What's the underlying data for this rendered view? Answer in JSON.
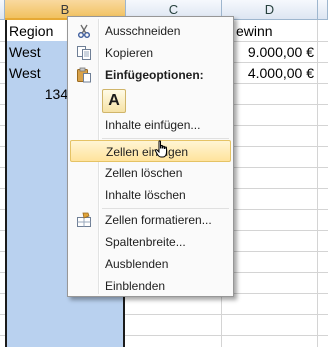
{
  "sheet": {
    "columns": [
      "B",
      "C",
      "D"
    ],
    "cells": {
      "b1": "Region",
      "b2": "West",
      "b3": "West",
      "b4_partial": "134.",
      "d1_partial": "ewinn",
      "d2_partial": "9.000,00 €",
      "d3_partial": "4.000,00 €"
    },
    "selection_color": "#b9d1ef"
  },
  "context_menu": {
    "items": [
      {
        "label": "Ausschneiden",
        "icon": "scissors-icon"
      },
      {
        "label": "Kopieren",
        "icon": "copy-icon"
      },
      {
        "label": "Einfügeoptionen:",
        "icon": "paste-icon"
      },
      {
        "label": "Inhalte einfügen...",
        "icon": ""
      },
      {
        "label": "Zellen einfügen",
        "icon": "",
        "hovered": true
      },
      {
        "label": "Zellen löschen",
        "icon": ""
      },
      {
        "label": "Inhalte löschen",
        "icon": ""
      },
      {
        "label": "Zellen formatieren...",
        "icon": "format-cells-icon"
      },
      {
        "label": "Spaltenbreite...",
        "icon": ""
      },
      {
        "label": "Ausblenden",
        "icon": ""
      },
      {
        "label": "Einblenden",
        "icon": ""
      }
    ],
    "paste_option_letter": "A",
    "hover_color": "#ffe39c"
  }
}
